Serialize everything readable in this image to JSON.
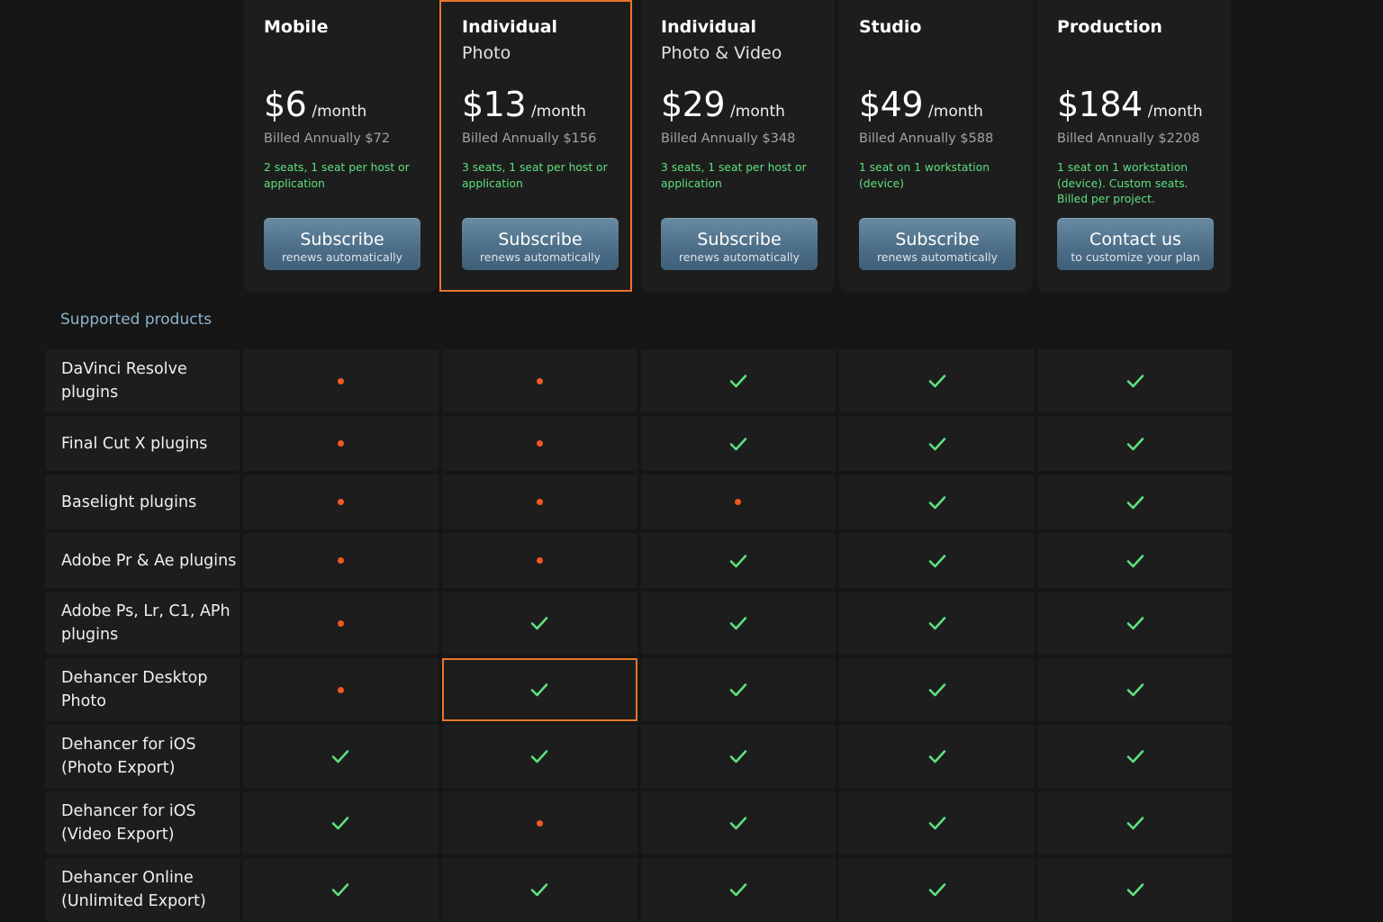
{
  "plans": [
    {
      "name": "Mobile",
      "subtitle": "",
      "price": "$6",
      "period": "/month",
      "billed": "Billed Annually $72",
      "seats": "2 seats, 1 seat per host or application",
      "button_label": "Subscribe",
      "button_sub": "renews automatically",
      "highlighted": false
    },
    {
      "name": "Individual",
      "subtitle": "Photo",
      "price": "$13",
      "period": "/month",
      "billed": "Billed Annually $156",
      "seats": "3 seats, 1 seat per host or application",
      "button_label": "Subscribe",
      "button_sub": "renews automatically",
      "highlighted": true
    },
    {
      "name": "Individual",
      "subtitle": "Photo & Video",
      "price": "$29",
      "period": "/month",
      "billed": "Billed Annually $348",
      "seats": "3 seats, 1 seat per host or application",
      "button_label": "Subscribe",
      "button_sub": "renews automatically",
      "highlighted": false
    },
    {
      "name": "Studio",
      "subtitle": "",
      "price": "$49",
      "period": "/month",
      "billed": "Billed Annually $588",
      "seats": "1 seat on 1 workstation (device)",
      "button_label": "Subscribe",
      "button_sub": "renews automatically",
      "highlighted": false
    },
    {
      "name": "Production",
      "subtitle": "",
      "price": "$184",
      "period": "/month",
      "billed": "Billed Annually $2208",
      "seats": "1 seat on 1 workstation (device). Custom seats. Billed per project.",
      "button_label": "Contact us",
      "button_sub": "to customize your plan",
      "highlighted": false
    }
  ],
  "section_title": "Supported products",
  "products": [
    {
      "name": "DaVinci Resolve plugins",
      "support": [
        false,
        false,
        true,
        true,
        true
      ]
    },
    {
      "name": "Final Cut X plugins",
      "support": [
        false,
        false,
        true,
        true,
        true
      ]
    },
    {
      "name": "Baselight plugins",
      "support": [
        false,
        false,
        false,
        true,
        true
      ]
    },
    {
      "name": "Adobe Pr & Ae plugins",
      "support": [
        false,
        false,
        true,
        true,
        true
      ]
    },
    {
      "name": "Adobe Ps, Lr, C1, APh plugins",
      "support": [
        false,
        true,
        true,
        true,
        true
      ]
    },
    {
      "name": "Dehancer Desktop Photo",
      "support": [
        false,
        true,
        true,
        true,
        true
      ]
    },
    {
      "name": "Dehancer for iOS (Photo Export)",
      "support": [
        true,
        true,
        true,
        true,
        true
      ]
    },
    {
      "name": "Dehancer for iOS (Video Export)",
      "support": [
        true,
        false,
        true,
        true,
        true
      ]
    },
    {
      "name": "Dehancer Online (Unlimited Export)",
      "support": [
        true,
        true,
        true,
        true,
        true
      ]
    }
  ],
  "highlighted_cell": {
    "product_index": 5,
    "plan_index": 1
  },
  "colors": {
    "accent_outline": "#e8772a",
    "check": "#5ee07e",
    "dot": "#f05a22",
    "button": "#557891",
    "section_title": "#8fb4cc"
  },
  "icons": {
    "supported": "check-icon",
    "unsupported": "dot-icon"
  }
}
